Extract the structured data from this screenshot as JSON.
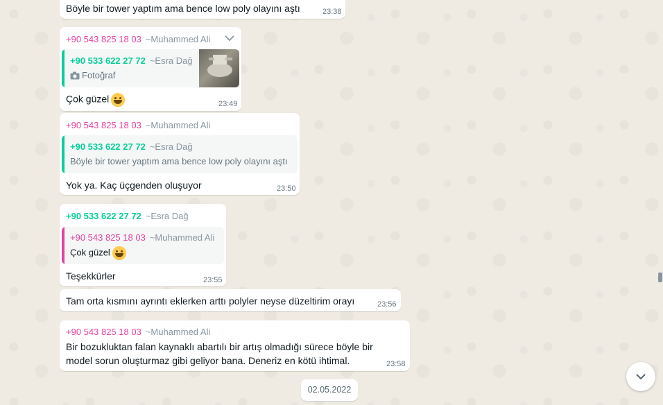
{
  "messages": [
    {
      "text": "Böyle bir tower yaptım ama bence low poly olayını aştı",
      "time": "23:38"
    },
    {
      "sender_phone": "+90 543 825 18 03",
      "sender_name": "~Muhammed Ali",
      "quote": {
        "phone": "+90 533 622 27 72",
        "name": "~Esra Dağ",
        "text": "Fotoğraf"
      },
      "text": "Çok güzel",
      "time": "23:49"
    },
    {
      "sender_phone": "+90 543 825 18 03",
      "sender_name": "~Muhammed Ali",
      "quote": {
        "phone": "+90 533 622 27 72",
        "name": "~Esra Dağ",
        "text": "Böyle bir tower yaptım ama bence low poly olayını aştı"
      },
      "text": "Yok ya. Kaç üçgenden oluşuyor",
      "time": "23:50"
    },
    {
      "sender_phone": "+90 533 622 27 72",
      "sender_name": "~Esra Dağ",
      "quote": {
        "phone": "+90 543 825 18 03",
        "name": "~Muhammed Ali",
        "text": "Çok güzel"
      },
      "text": "Teşekkürler",
      "time": "23:55"
    },
    {
      "text": "Tam orta kısmını ayrıntı eklerken arttı polyler neyse düzeltirim orayı",
      "time": "23:56"
    },
    {
      "sender_phone": "+90 543 825 18 03",
      "sender_name": "~Muhammed Ali",
      "text_line1": "Bir bozukluktan falan kaynaklı abartılı bir artış olmadığı sürece böyle bir",
      "text_line2": "model sorun oluşturmaz gibi geliyor bana. Deneriz en kötü ihtimal.",
      "time": "23:58"
    }
  ],
  "date_separator": "02.05.2022",
  "icons": {
    "menu": "chevron-down-icon",
    "photo": "camera-icon",
    "emoji": "grinning-face-emoji",
    "scroll": "chevron-down-icon"
  },
  "colors": {
    "pink_sender": "#e542a3",
    "green_sender": "#06cf9c",
    "background": "#efeae2",
    "bubble": "#ffffff"
  }
}
